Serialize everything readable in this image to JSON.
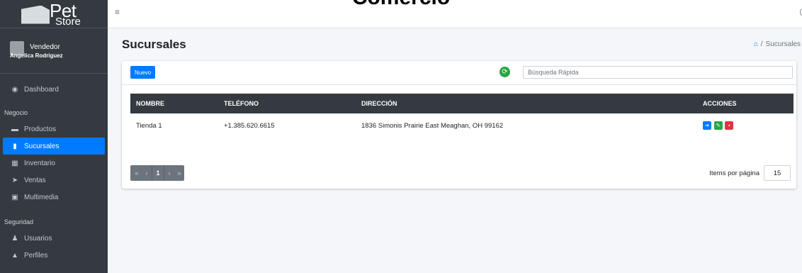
{
  "overlay": {
    "title": "Comercio"
  },
  "brand": {
    "pet": "Pet",
    "store": "Store"
  },
  "user": {
    "role": "Vendedor",
    "name": "Angelica Rodriguez"
  },
  "sidebar": {
    "dashboard": "Dashboard",
    "section_negocio": "Negocio",
    "productos": "Productos",
    "sucursales": "Sucursales",
    "inventario": "Inventario",
    "ventas": "Ventas",
    "multimedia": "Multimedia",
    "section_seguridad": "Seguridad",
    "usuarios": "Usuarios",
    "perfiles": "Perfiles"
  },
  "topbar": {
    "menu_icon": "hamburger-icon"
  },
  "page": {
    "title": "Sucursales",
    "breadcrumb_sep": "/",
    "breadcrumb_current": "Sucursales"
  },
  "toolbar": {
    "nuevo_label": "Nuevo",
    "search_placeholder": "Búsqueda Rápida",
    "search_value": ""
  },
  "table": {
    "headers": {
      "nombre": "NOMBRE",
      "telefono": "TELÉFONO",
      "direccion": "DIRECCIÓN",
      "acciones": "ACCIONES"
    },
    "rows": [
      {
        "nombre": "Tienda 1",
        "telefono": "+1.385.620.6615",
        "direccion": "1836 Simonis Prairie East Meaghan, OH 99162"
      }
    ]
  },
  "pagination": {
    "first": "«",
    "prev": "‹",
    "current": "1",
    "next": "›",
    "last": "»"
  },
  "items_per_page": {
    "label": "Items por página",
    "value": "15"
  },
  "colors": {
    "sidebar_bg": "#343a40",
    "primary": "#007bff",
    "success": "#28a745",
    "danger": "#dc3545",
    "content_bg": "#f4f6f9"
  }
}
